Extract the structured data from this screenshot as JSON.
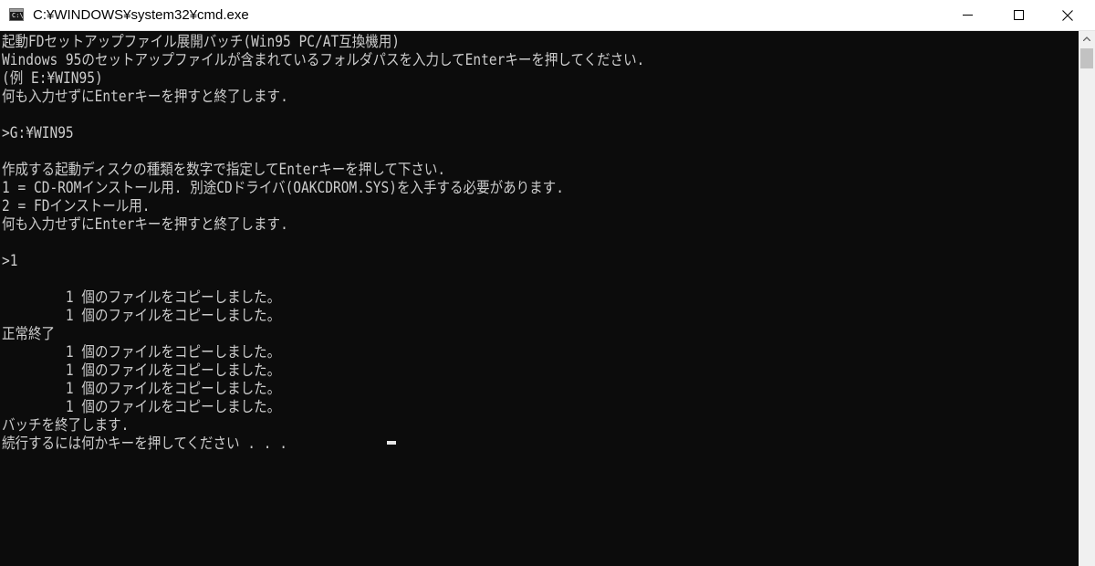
{
  "window": {
    "title": "C:¥WINDOWS¥system32¥cmd.exe",
    "icon_label": "C:\\"
  },
  "console": {
    "lines": [
      "起動FDセットアップファイル展開バッチ(Win95 PC/AT互換機用)",
      "Windows 95のセットアップファイルが含まれているフォルダパスを入力してEnterキーを押してください.",
      "(例 E:¥WIN95)",
      "何も入力せずにEnterキーを押すと終了します.",
      "",
      ">G:¥WIN95",
      "",
      "作成する起動ディスクの種類を数字で指定してEnterキーを押して下さい.",
      "1 = CD-ROMインストール用. 別途CDドライバ(OAKCDROM.SYS)を入手する必要があります.",
      "2 = FDインストール用.",
      "何も入力せずにEnterキーを押すと終了します.",
      "",
      ">1",
      "",
      "        1 個のファイルをコピーしました。",
      "        1 個のファイルをコピーしました。",
      "正常終了",
      "        1 個のファイルをコピーしました。",
      "        1 個のファイルをコピーしました。",
      "        1 個のファイルをコピーしました。",
      "        1 個のファイルをコピーしました。",
      "バッチを終了します.",
      "続行するには何かキーを押してください . . . "
    ]
  },
  "colors": {
    "console_background": "#0c0c0c",
    "console_text": "#cccccc",
    "titlebar_background": "#ffffff",
    "scrollbar_track": "#f0f0f0",
    "scrollbar_thumb": "#c2c2c2"
  },
  "icons": {
    "app": "cmd-app-icon",
    "minimize": "minimize-icon",
    "maximize": "maximize-icon",
    "close": "close-icon",
    "scroll_up": "arrow-up-icon"
  }
}
